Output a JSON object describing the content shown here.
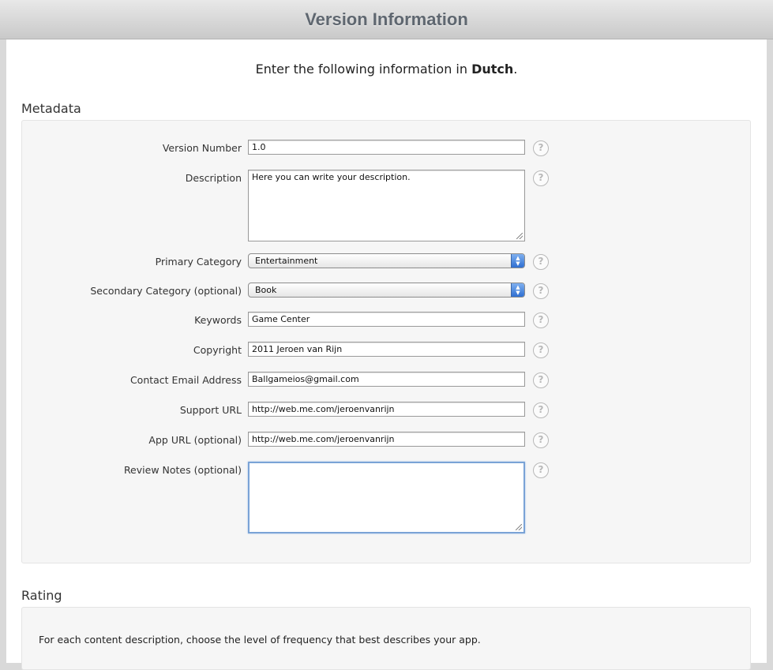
{
  "header": {
    "title": "Version Information"
  },
  "intro": {
    "prefix": "Enter the following information in ",
    "language": "Dutch",
    "suffix": "."
  },
  "metadata": {
    "title": "Metadata",
    "fields": {
      "version_number": {
        "label": "Version Number",
        "value": "1.0"
      },
      "description": {
        "label": "Description",
        "value": "Here you can write your description."
      },
      "primary_category": {
        "label": "Primary Category",
        "value": "Entertainment"
      },
      "secondary_category": {
        "label": "Secondary Category (optional)",
        "value": "Book"
      },
      "keywords": {
        "label": "Keywords",
        "value": "Game Center"
      },
      "copyright": {
        "label": "Copyright",
        "value": "2011 Jeroen van Rijn"
      },
      "contact_email": {
        "label": "Contact Email Address",
        "value": "Ballgameios@gmail.com"
      },
      "support_url": {
        "label": "Support URL",
        "value": "http://web.me.com/jeroenvanrijn"
      },
      "app_url": {
        "label": "App URL (optional)",
        "value": "http://web.me.com/jeroenvanrijn"
      },
      "review_notes": {
        "label": "Review Notes (optional)",
        "value": ""
      }
    },
    "help_glyph": "?"
  },
  "rating": {
    "title": "Rating",
    "instructions": "For each content description, choose the level of frequency that best describes your app."
  },
  "icons": {
    "help": "help-circle-icon",
    "select_arrows": "up-down-arrows-icon"
  },
  "colors": {
    "focus": "#7aa3d6",
    "select_arrow": "#2f6fd1",
    "title_text": "#5f6770"
  }
}
